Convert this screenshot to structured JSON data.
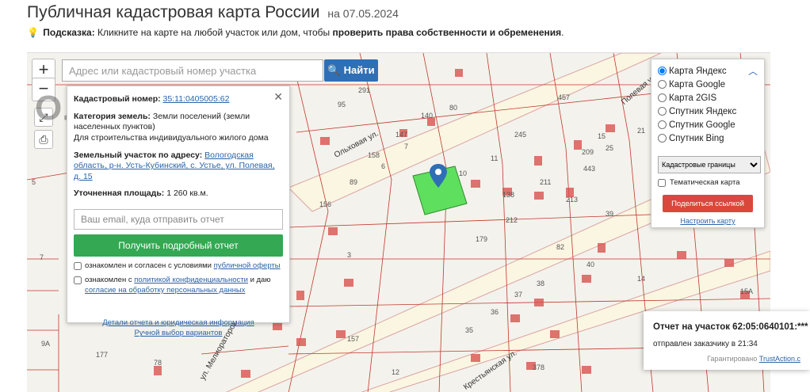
{
  "header": {
    "title": "Публичная кадастровая карта России",
    "date_prefix": "на",
    "date": "07.05.2024"
  },
  "hint": {
    "label": "Подсказка:",
    "text": "Кликните на карте на любой участок или дом, чтобы",
    "bold_text": "проверить права собственности и обременения",
    "end": "."
  },
  "search": {
    "placeholder": "Адрес или кадастровый номер участка",
    "button_label": "Найти"
  },
  "map_controls": {
    "zoom_in": "+",
    "zoom_out": "−"
  },
  "watermark": "ОЛИМП",
  "info": {
    "cadastral_label": "Кадастровый номер:",
    "cadastral_value": "35:11:0405005:62",
    "category_label": "Категория земель:",
    "category_value": "Земли поселений (земли населенных пунктов)",
    "use": "Для строительства индивидуального жилого дома",
    "address_label": "Земельный участок по адресу:",
    "address_value": "Вологодская область, р-н. Усть-Кубинский, с. Устье, ул. Полевая, д. 15",
    "area_label": "Уточненная площадь:",
    "area_value": "1 260 кв.м.",
    "email_placeholder": "Ваш email, куда отправить отчет",
    "report_button": "Получить подробный отчет",
    "agree1_prefix": "ознакомлен и согласен с условиями",
    "agree1_link": "публичной оферты",
    "agree2_prefix": "ознакомлен с",
    "agree2_link1": "политикой конфиденциальности",
    "agree2_mid": "и даю",
    "agree2_link2": "согласие на обработку персональных данных",
    "details_link": "Детали отчета и юридическая информация",
    "manual_link": "Ручной выбор вариантов"
  },
  "layers": {
    "options": [
      "Карта Яндекс",
      "Карта Google",
      "Карта 2GIS",
      "Спутник Яндекс",
      "Спутник Google",
      "Спутник Bing"
    ],
    "selected": "Карта Яндекс",
    "select_value": "Кадастровые границы",
    "thematic": "Тематическая карта",
    "share_button": "Поделиться ссылкой",
    "setup_link": "Настроить карту"
  },
  "toast": {
    "title": "Отчет на участок 62:05:0640101:***",
    "status": "отправлен заказчику в 21:34",
    "guarantee_prefix": "Гарантировано",
    "guarantee_brand": "TrustAction.c"
  },
  "map": {
    "streets": [
      "Ольховая ул.",
      "Полевая ул.",
      "Крестьянская ул.",
      "ул. Мелиораторов"
    ],
    "parcel_numbers": [
      "291",
      "80",
      "95",
      "147",
      "140",
      "7",
      "158",
      "6",
      "10",
      "11",
      "245",
      "457",
      "15",
      "443",
      "209",
      "25",
      "21",
      "89",
      "156",
      "138",
      "211",
      "213",
      "39",
      "212",
      "179",
      "3",
      "82",
      "40",
      "38",
      "14",
      "37",
      "35",
      "36",
      "157",
      "378",
      "12",
      "15А",
      "9А",
      "7",
      "5",
      "177",
      "78"
    ],
    "colors": {
      "selected_parcel": "#5ee05e",
      "pin": "#2f6fb6",
      "house": "#d9534f",
      "road": "#fbf6e2",
      "boundary": "#c0392b"
    }
  }
}
